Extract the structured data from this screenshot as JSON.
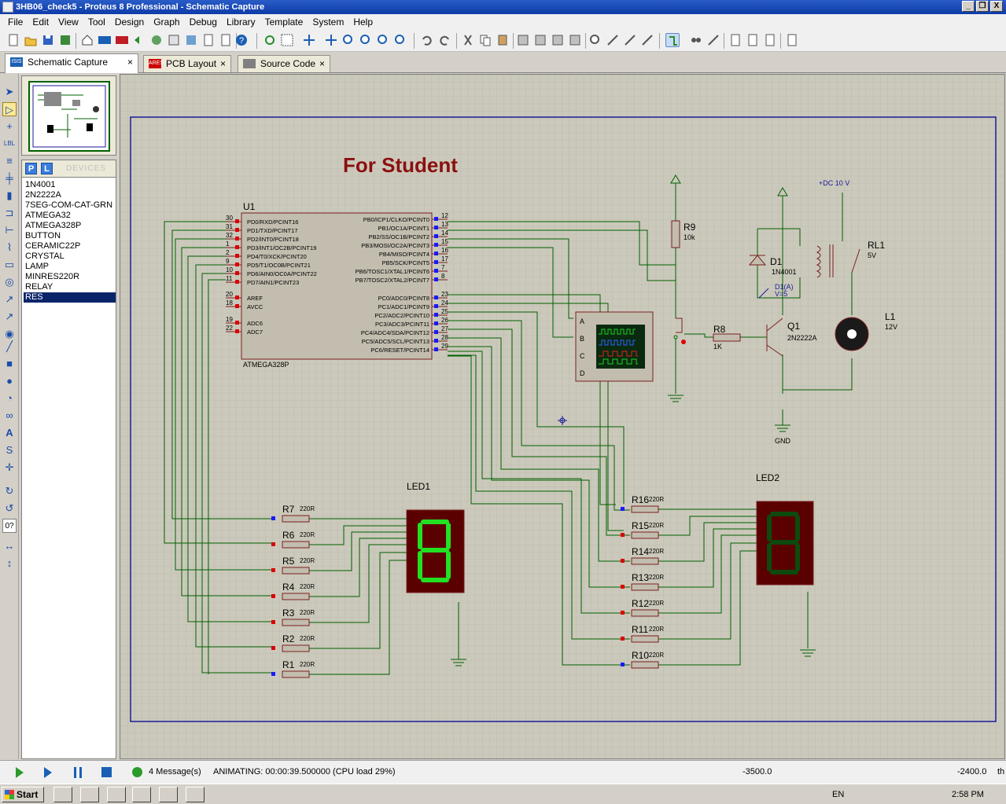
{
  "window": {
    "title": "3HB06_check5 - Proteus 8 Professional - Schematic Capture",
    "buttons": [
      "_",
      "❐",
      "X"
    ]
  },
  "menu": [
    "File",
    "Edit",
    "View",
    "Tool",
    "Design",
    "Graph",
    "Debug",
    "Library",
    "Template",
    "System",
    "Help"
  ],
  "tabs": [
    {
      "label": "Schematic Capture",
      "icon": "ISIS",
      "close": "×"
    },
    {
      "label": "PCB Layout",
      "icon": "ARES",
      "close": "×"
    },
    {
      "label": "Source Code",
      "icon": "code",
      "close": "×"
    }
  ],
  "devices": {
    "header_p": "P",
    "header_l": "L",
    "header_label": "DEVICES",
    "items": [
      "1N4001",
      "2N2222A",
      "7SEG-COM-CAT-GRN",
      "ATMEGA32",
      "ATMEGA328P",
      "BUTTON",
      "CERAMIC22P",
      "CRYSTAL",
      "LAMP",
      "MINRES220R",
      "RELAY",
      "RES"
    ],
    "selected": "RES"
  },
  "lefttools": {
    "angle": "0?"
  },
  "schematic": {
    "title": "For Student",
    "mcu": {
      "ref": "U1",
      "part": "ATMEGA328P",
      "left_pins": [
        [
          "30",
          "PD0/RXD/PCINT16"
        ],
        [
          "31",
          "PD1/TXD/PCINT17"
        ],
        [
          "32",
          "PD2/INT0/PCINT18"
        ],
        [
          "1",
          "PD3/INT1/OC2B/PCINT19"
        ],
        [
          "2",
          "PD4/T0/XCK/PCINT20"
        ],
        [
          "9",
          "PD5/T1/OC0B/PCINT21"
        ],
        [
          "10",
          "PD6/AIN0/OC0A/PCINT22"
        ],
        [
          "11",
          "PD7/AIN1/PCINT23"
        ],
        [
          "20",
          "AREF"
        ],
        [
          "18",
          "AVCC"
        ],
        [
          "19",
          "ADC6"
        ],
        [
          "22",
          "ADC7"
        ]
      ],
      "right_pins": [
        [
          "12",
          "PB0/ICP1/CLKO/PCINT0"
        ],
        [
          "13",
          "PB1/OC1A/PCINT1"
        ],
        [
          "14",
          "PB2/SS/OC1B/PCINT2"
        ],
        [
          "15",
          "PB3/MOSI/OC2A/PCINT3"
        ],
        [
          "16",
          "PB4/MISO/PCINT4"
        ],
        [
          "17",
          "PB5/SCK/PCINT5"
        ],
        [
          "7",
          "PB6/TOSC1/XTAL1/PCINT6"
        ],
        [
          "8",
          "PB7/TOSC2/XTAL2/PCINT7"
        ],
        [
          "23",
          "PC0/ADC0/PCINT8"
        ],
        [
          "24",
          "PC1/ADC1/PCINT9"
        ],
        [
          "25",
          "PC2/ADC2/PCINT10"
        ],
        [
          "26",
          "PC3/ADC3/PCINT11"
        ],
        [
          "27",
          "PC4/ADC4/SDA/PCINT12"
        ],
        [
          "28",
          "PC5/ADC5/SCL/PCINT13"
        ],
        [
          "29",
          "PC6/RESET/PCINT14"
        ]
      ]
    },
    "r9": {
      "ref": "R9",
      "value": "10k"
    },
    "r8": {
      "ref": "R8",
      "value": "1K"
    },
    "d1": {
      "ref": "D1",
      "part": "1N4001",
      "probe": "D1(A)",
      "probe_v": "V=5"
    },
    "q1": {
      "ref": "Q1",
      "part": "2N2222A"
    },
    "rl1": {
      "ref": "RL1",
      "value": "5V"
    },
    "l1": {
      "ref": "L1",
      "value": "12V"
    },
    "dc": {
      "label": "+DC 10 V"
    },
    "gnd": {
      "label": "GND"
    },
    "scope": {
      "ch": [
        "A",
        "B",
        "C",
        "D"
      ]
    },
    "led1": {
      "ref": "LED1"
    },
    "led2": {
      "ref": "LED2"
    },
    "res_left": [
      {
        "ref": "R7",
        "value": "220R"
      },
      {
        "ref": "R6",
        "value": "220R"
      },
      {
        "ref": "R5",
        "value": "220R"
      },
      {
        "ref": "R4",
        "value": "220R"
      },
      {
        "ref": "R3",
        "value": "220R"
      },
      {
        "ref": "R2",
        "value": "220R"
      },
      {
        "ref": "R1",
        "value": "220R"
      }
    ],
    "res_right": [
      {
        "ref": "R16",
        "value": "220R"
      },
      {
        "ref": "R15",
        "value": "220R"
      },
      {
        "ref": "R14",
        "value": "220R"
      },
      {
        "ref": "R13",
        "value": "220R"
      },
      {
        "ref": "R12",
        "value": "220R"
      },
      {
        "ref": "R11",
        "value": "220R"
      },
      {
        "ref": "R10",
        "value": "220R"
      }
    ]
  },
  "status": {
    "messages": "4 Message(s)",
    "animating": "ANIMATING: 00:00:39.500000 (CPU load 29%)",
    "x": "-3500.0",
    "y": "-2400.0",
    "units": "th"
  },
  "taskbar": {
    "start": "Start",
    "lang": "EN",
    "time": "2:58 PM"
  },
  "colors": {
    "wire": "#006000",
    "body": "#c2bdae",
    "title": "#8b1010",
    "sheet": "#1a1a9a",
    "led_on": "#22e022",
    "led_bg": "#5a0000"
  }
}
